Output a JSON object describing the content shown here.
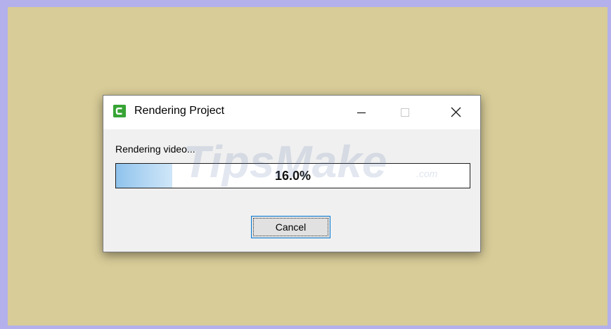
{
  "dialog": {
    "title": "Rendering Project",
    "app_icon": "camtasia-c-icon",
    "status_text": "Rendering video...",
    "progress": {
      "percent": 16.0,
      "label": "16.0%"
    },
    "cancel_label": "Cancel"
  },
  "window_controls": {
    "minimize_icon": "minimize-icon",
    "maximize_icon": "maximize-icon",
    "close_icon": "close-icon"
  },
  "watermark": {
    "brand": "TipsMake",
    "suffix": ".com"
  },
  "colors": {
    "desktop_background": "#d8cc98",
    "frame_border": "#b3b0ec",
    "progress_fill": "#8fc3ec",
    "app_icon_green": "#37a435",
    "focus_border": "#0078d7"
  }
}
